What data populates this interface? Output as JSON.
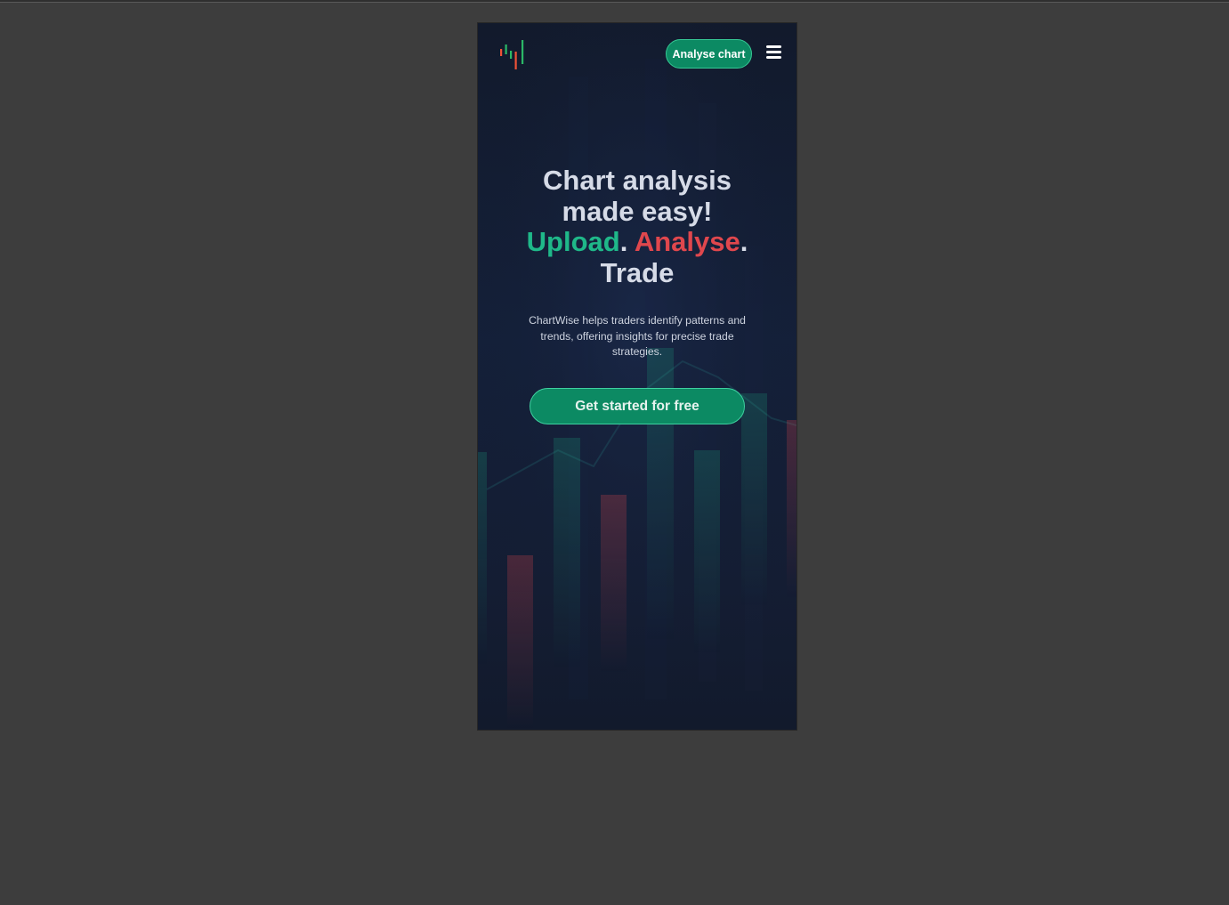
{
  "header": {
    "logo_icon": "candlestick-logo-icon",
    "cta_label": "Analyse chart",
    "menu_icon": "hamburger-menu-icon"
  },
  "hero": {
    "title_line1": "Chart analysis",
    "title_line2": "made easy!",
    "word_upload": "Upload",
    "word_analyse": "Analyse",
    "word_trade": "Trade",
    "dot": ".",
    "description": "ChartWise helps traders identify patterns and trends, offering insights for precise trade strategies.",
    "cta_label": "Get started for free"
  },
  "colors": {
    "accent_green": "#0c8a63",
    "highlight_green": "#1fb889",
    "highlight_red": "#e0474d",
    "background": "#121a2c",
    "outer_background": "#3d3d3d"
  }
}
